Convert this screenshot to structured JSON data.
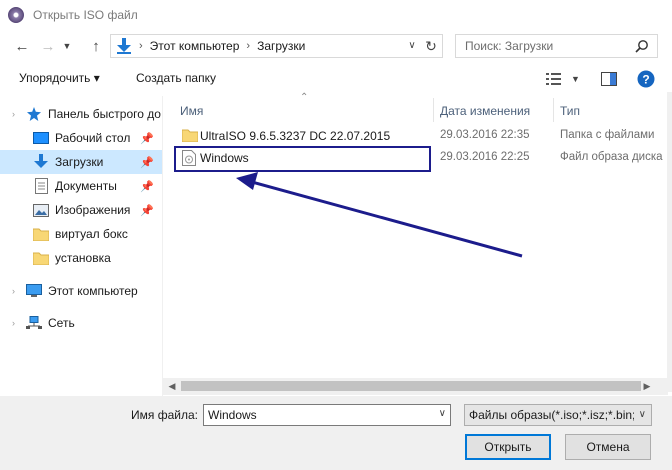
{
  "window": {
    "title": "Открыть ISO файл"
  },
  "address": {
    "crumbs": [
      "Этот компьютер",
      "Загрузки"
    ]
  },
  "search": {
    "placeholder": "Поиск: Загрузки"
  },
  "toolbar": {
    "organize_label": "Упорядочить ▾",
    "new_folder_label": "Создать папку"
  },
  "sidebar": {
    "items": [
      {
        "label": "Панель быстрого до",
        "icon": "star-icon"
      },
      {
        "label": "Рабочий стол",
        "icon": "desktop-icon",
        "pinned": true
      },
      {
        "label": "Загрузки",
        "icon": "download-icon",
        "pinned": true,
        "selected": true
      },
      {
        "label": "Документы",
        "icon": "documents-icon",
        "pinned": true
      },
      {
        "label": "Изображения",
        "icon": "pictures-icon",
        "pinned": true
      },
      {
        "label": "виртуал бокс",
        "icon": "folder-icon"
      },
      {
        "label": "установка",
        "icon": "folder-icon"
      },
      {
        "label": "Этот компьютер",
        "icon": "computer-icon"
      },
      {
        "label": "Сеть",
        "icon": "network-icon"
      }
    ]
  },
  "filelist": {
    "columns": {
      "name": "Имя",
      "date": "Дата изменения",
      "type": "Тип"
    },
    "rows": [
      {
        "name": "UltraISO 9.6.5.3237 DC 22.07.2015",
        "date": "29.03.2016 22:35",
        "type": "Папка с файлами",
        "icon": "folder-icon"
      },
      {
        "name": "Windows",
        "date": "29.03.2016 22:25",
        "type": "Файл образа диска",
        "icon": "disc-image-icon"
      }
    ]
  },
  "bottom": {
    "filename_label": "Имя файла:",
    "filename_value": "Windows",
    "filter_value": "Файлы образы(*.iso;*.isz;*.bin;",
    "open_label": "Открыть",
    "cancel_label": "Отмена"
  },
  "colors": {
    "accent": "#0078d7",
    "selection": "#cce8ff",
    "annotation": "#1c1c8c"
  }
}
